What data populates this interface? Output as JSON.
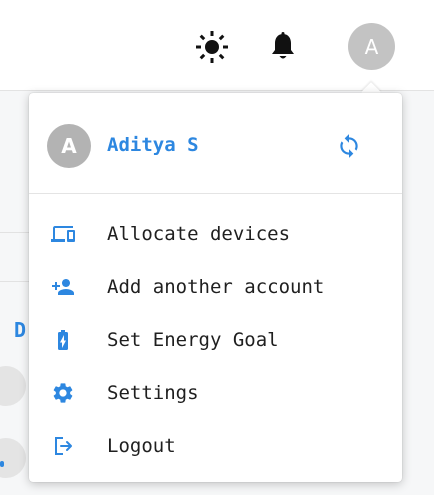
{
  "header": {
    "avatar_initial": "A",
    "icons": [
      "sun-icon",
      "bell-icon"
    ]
  },
  "background": {
    "partial_text": "D"
  },
  "account_menu": {
    "user": {
      "initial": "A",
      "name": "Aditya S"
    },
    "switch_icon": "sync-icon",
    "items": [
      {
        "label": "Allocate devices",
        "icon": "devices-icon"
      },
      {
        "label": "Add another account",
        "icon": "person-add-icon"
      },
      {
        "label": "Set Energy Goal",
        "icon": "battery-charging-icon"
      },
      {
        "label": "Settings",
        "icon": "gear-icon"
      },
      {
        "label": "Logout",
        "icon": "logout-icon"
      }
    ]
  },
  "colors": {
    "accent": "#2d87e0",
    "text": "#1f1f1f",
    "avatar_bg": "#b3b3b3",
    "background": "#f6f7f8"
  }
}
